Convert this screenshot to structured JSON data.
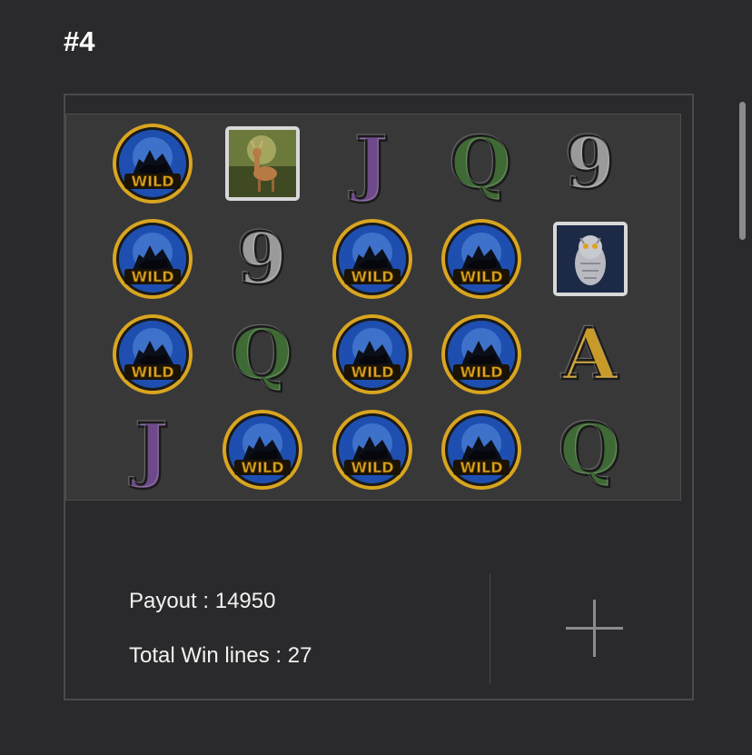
{
  "result": {
    "title": "#4",
    "payout_label": "Payout : 14950",
    "win_lines_label": "Total Win lines : 27"
  },
  "reels": [
    [
      "wild",
      "deer",
      "J",
      "Q",
      "9"
    ],
    [
      "wild",
      "9",
      "wild",
      "wild",
      "owl"
    ],
    [
      "wild",
      "Q",
      "wild",
      "wild",
      "A"
    ],
    [
      "J",
      "wild",
      "wild",
      "wild",
      "Q"
    ]
  ],
  "wild_text": "WILD",
  "icons": {
    "add": "plus-icon"
  },
  "colors": {
    "background": "#2a292b",
    "grid_bg": "#383838",
    "wild_gold": "#d9a520",
    "wild_blue": "#1e4fb0",
    "letter_j": "#6e4a8a",
    "letter_q": "#3f6a35",
    "letter_9": "#9a9a9a",
    "letter_a": "#c79a2a"
  }
}
